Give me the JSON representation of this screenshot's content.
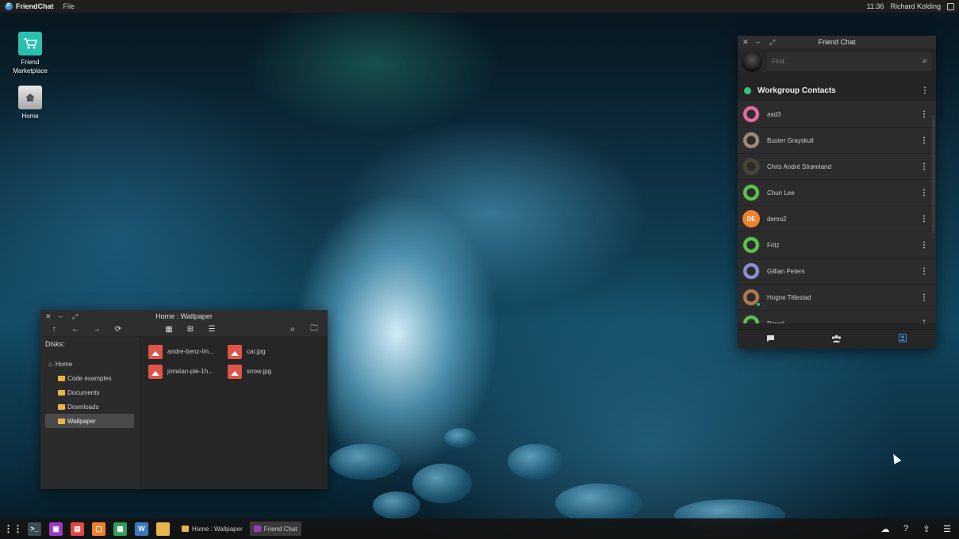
{
  "topbar": {
    "app_name": "FriendChat",
    "menu_file": "File",
    "time": "11:36",
    "user": "Richard Kolding"
  },
  "desktop": {
    "icons": [
      {
        "label_line1": "Friend",
        "label_line2": "Marketplace"
      },
      {
        "label_line1": "Home",
        "label_line2": ""
      }
    ]
  },
  "file_manager": {
    "title": "Home : Wallpaper",
    "disks_label": "Disks:",
    "tree": [
      "Home",
      "Code examples",
      "Documents",
      "Downloads",
      "Wallpaper"
    ],
    "selected": "Wallpaper",
    "files": [
      "andre-benz-Im...",
      "car.jpg",
      "jonatan-pie-1h...",
      "snow.jpg"
    ]
  },
  "chat": {
    "title": "Friend Chat",
    "search_placeholder": "Find..",
    "group_name": "Workgroup Contacts",
    "contacts": [
      {
        "name": "asd3",
        "color": "#e96aa0"
      },
      {
        "name": "Buster Grayskull",
        "color": "#9a8a7a"
      },
      {
        "name": "Chris André Strømland",
        "color": "#4a4634"
      },
      {
        "name": "Chun Lee",
        "color": "#5cc24e"
      },
      {
        "name": "demo2",
        "color": "#f0822f",
        "initials": "DE"
      },
      {
        "name": "Fritz",
        "color": "#5cc24e"
      },
      {
        "name": "Gillian Peters",
        "color": "#8b8fd6"
      },
      {
        "name": "Hogne Titlestad",
        "color": "#b07a4e"
      },
      {
        "name": "Pawel",
        "color": "#5cc24e"
      }
    ]
  },
  "taskbar": {
    "tasks": [
      "Home : Wallpaper",
      "Friend Chat"
    ],
    "active_task": "Friend Chat"
  }
}
